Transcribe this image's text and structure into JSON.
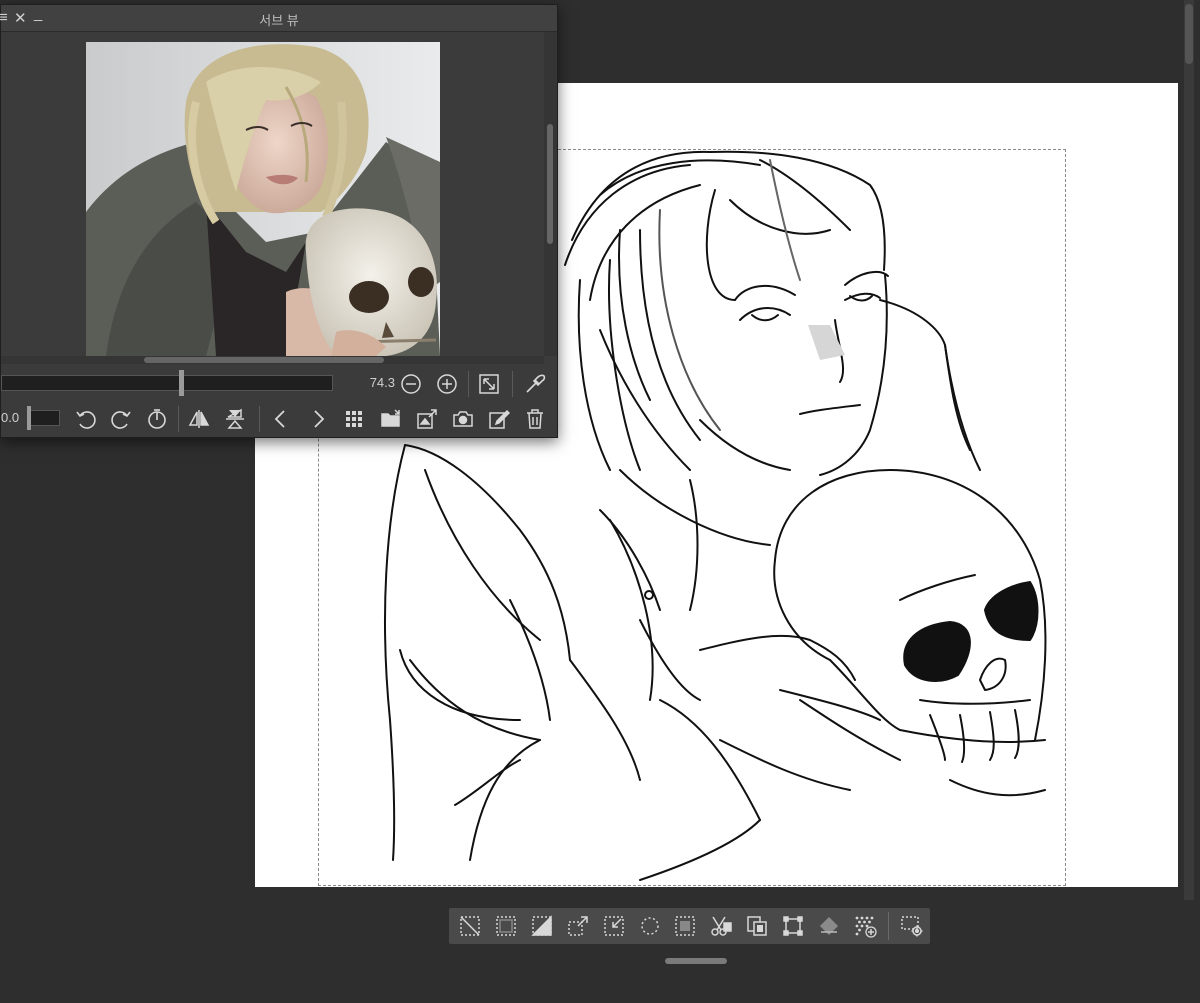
{
  "canvas": {
    "paper_color": "#ffffff",
    "background_color": "#2e2e2e"
  },
  "subview": {
    "title": "서브 뷰",
    "zoom_value": "74.3",
    "rotation_value": "0.0",
    "icons": {
      "menu": "hamburger-icon",
      "close": "close-icon",
      "minimize": "minimize-icon"
    },
    "toolbar": [
      "rotate-left-icon",
      "rotate-right-icon",
      "reset-rotation-icon",
      "flip-horizontal-icon",
      "flip-vertical-icon",
      "previous-icon",
      "next-icon",
      "grid-icon",
      "open-file-icon",
      "import-icon",
      "camera-icon",
      "edit-icon",
      "trash-icon"
    ]
  },
  "selection_launcher": {
    "icons": [
      "deselect-icon",
      "select-all-icon",
      "invert-selection-icon",
      "expand-selection-icon",
      "shrink-selection-icon",
      "select-similar-icon",
      "selection-border-icon",
      "cut-paste-icon",
      "copy-paste-icon",
      "transform-icon",
      "fill-icon",
      "add-screentone-icon",
      "launcher-settings-icon"
    ]
  }
}
